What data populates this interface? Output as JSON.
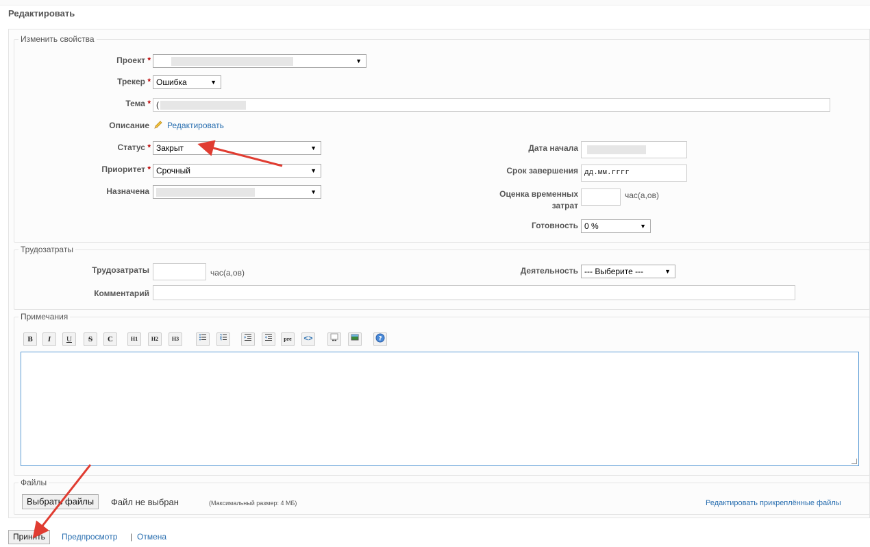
{
  "page_title": "Редактировать",
  "properties": {
    "legend": "Изменить свойства",
    "project": {
      "label": "Проект",
      "required": "*"
    },
    "tracker": {
      "label": "Трекер",
      "required": "*",
      "value": "Ошибка"
    },
    "subject": {
      "label": "Тема",
      "required": "*",
      "value": "("
    },
    "description": {
      "label": "Описание",
      "edit_link": "Редактировать",
      "icon": "pencil-icon"
    },
    "status": {
      "label": "Статус",
      "required": "*",
      "value": "Закрыт"
    },
    "priority": {
      "label": "Приоритет",
      "required": "*",
      "value": "Срочный"
    },
    "assigned": {
      "label": "Назначена"
    },
    "start_date": {
      "label": "Дата начала"
    },
    "due_date": {
      "label": "Срок завершения",
      "value": "дд.мм.гггг"
    },
    "estimate": {
      "label_line1": "Оценка временных",
      "label_line2": "затрат",
      "unit": "час(а,ов)"
    },
    "done": {
      "label": "Готовность",
      "value": "0 %"
    }
  },
  "time": {
    "legend": "Трудозатраты",
    "hours": {
      "label": "Трудозатраты",
      "unit": "час(а,ов)"
    },
    "activity": {
      "label": "Деятельность",
      "value": "--- Выберите ---"
    },
    "comment": {
      "label": "Комментарий"
    }
  },
  "notes": {
    "legend": "Примечания",
    "toolbar": {
      "bold": "B",
      "italic": "I",
      "underline": "U",
      "strike": "S",
      "code": "C",
      "h1": "H1",
      "h2": "H2",
      "h3": "H3",
      "pre": "pre"
    }
  },
  "files": {
    "legend": "Файлы",
    "choose_button": "Выбрать файлы",
    "no_file": "Файл не выбран",
    "max_size": "(Максимальный размер: 4 МБ)",
    "edit_attachments": "Редактировать прикреплённые файлы"
  },
  "actions": {
    "submit": "Принять",
    "preview": "Предпросмотр",
    "separator": "|",
    "cancel": "Отмена"
  },
  "colors": {
    "link": "#2a6fb0",
    "required": "#bb0000",
    "annotation_arrow": "#e03c31",
    "textarea_focus": "#5b9bd5"
  }
}
